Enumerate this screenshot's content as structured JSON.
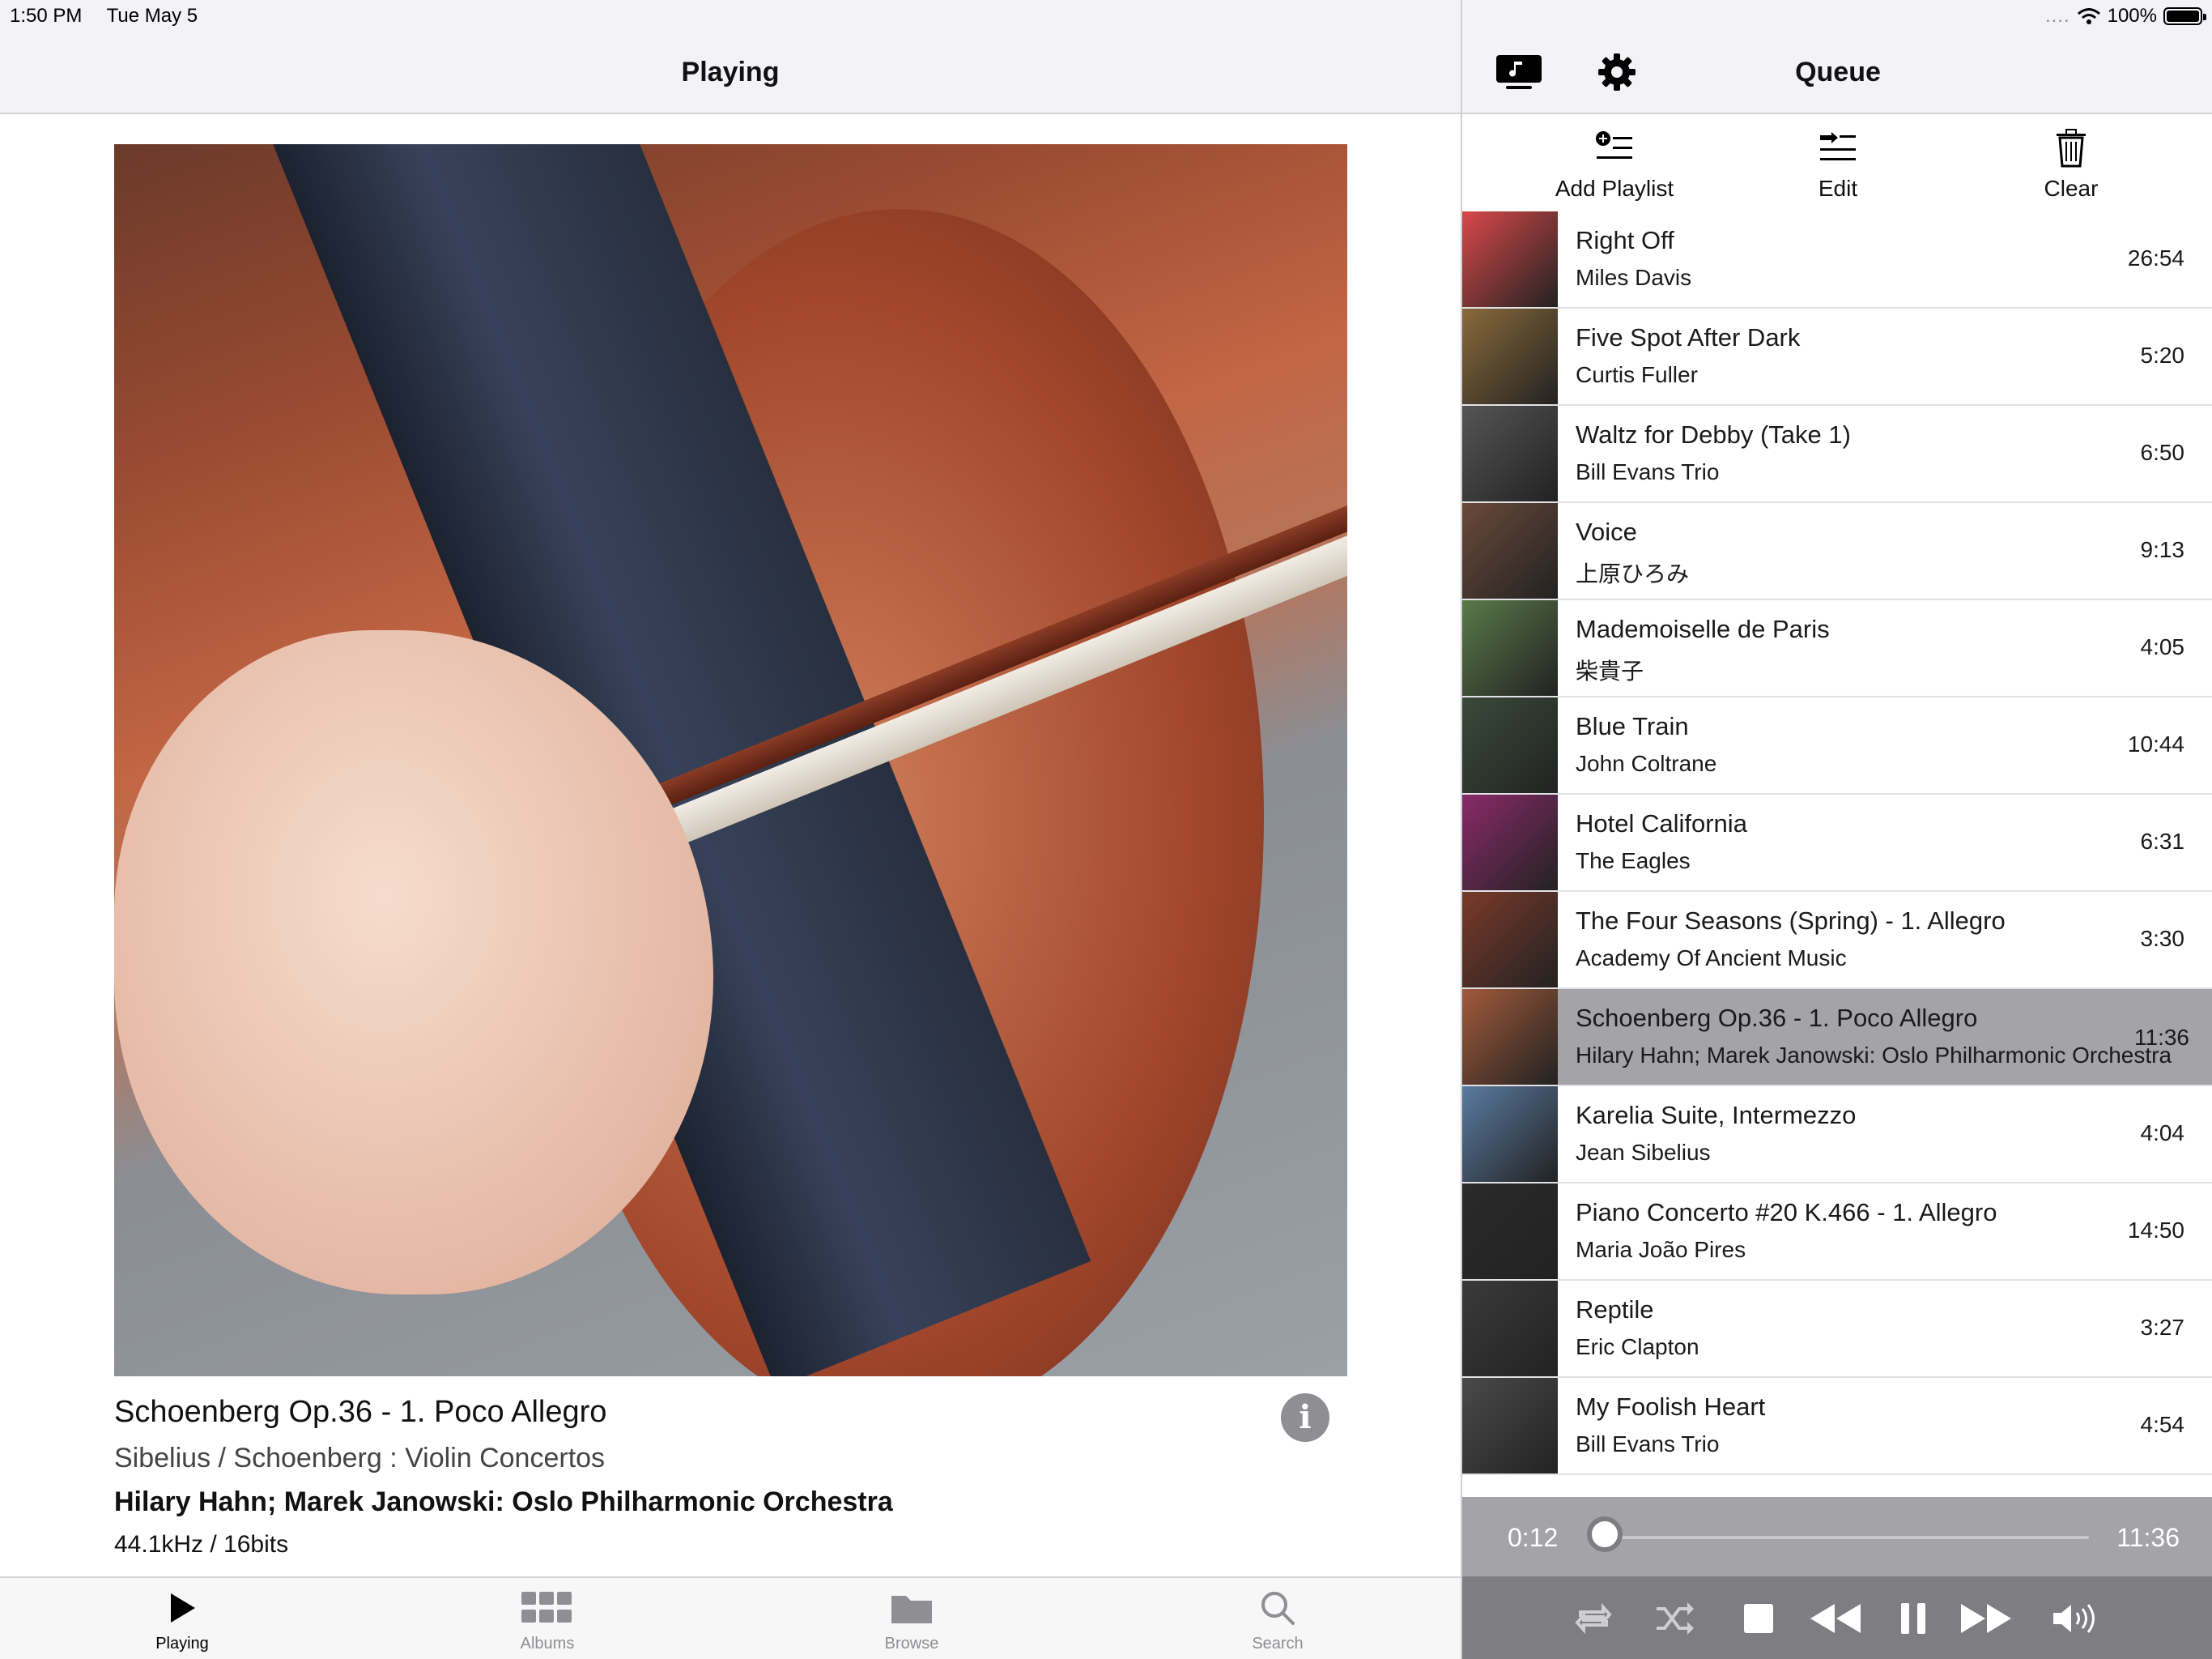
{
  "status_bar": {
    "time": "1:50 PM",
    "date": "Tue May 5",
    "signal": "....",
    "battery_label": "100%",
    "battery_level": 1.0
  },
  "now_playing": {
    "header_title": "Playing",
    "artwork_icon": "cello-album-art",
    "track_title": "Schoenberg Op.36 - 1. Poco Allegro",
    "album": "Sibelius / Schoenberg : Violin Concertos",
    "artist": "Hilary Hahn; Marek Janowski: Oslo Philharmonic Orchestra",
    "format": "44.1kHz / 16bits",
    "info_label": "i"
  },
  "tab_bar": {
    "tabs": [
      {
        "label": "Playing",
        "icon": "play-icon",
        "active": true
      },
      {
        "label": "Albums",
        "icon": "grid-icon",
        "active": false
      },
      {
        "label": "Browse",
        "icon": "folder-icon",
        "active": false
      },
      {
        "label": "Search",
        "icon": "search-icon",
        "active": false
      }
    ]
  },
  "queue": {
    "header_title": "Queue",
    "actions": {
      "add_playlist": "Add Playlist",
      "edit": "Edit",
      "clear": "Clear"
    },
    "items": [
      {
        "title": "Right Off",
        "artist": "Miles Davis",
        "duration": "26:54",
        "thumb": "#d9484a"
      },
      {
        "title": "Five Spot After Dark",
        "artist": "Curtis Fuller",
        "duration": "5:20",
        "thumb": "#8a6a3a"
      },
      {
        "title": "Waltz for Debby (Take 1)",
        "artist": "Bill Evans Trio",
        "duration": "6:50",
        "thumb": "#555555"
      },
      {
        "title": "Voice",
        "artist": "上原ひろみ",
        "duration": "9:13",
        "thumb": "#6a4a3a"
      },
      {
        "title": "Mademoiselle de Paris",
        "artist": "柴貴子",
        "duration": "4:05",
        "thumb": "#5a7a4a"
      },
      {
        "title": "Blue Train",
        "artist": "John Coltrane",
        "duration": "10:44",
        "thumb": "#3a4a3a"
      },
      {
        "title": "Hotel California",
        "artist": "The Eagles",
        "duration": "6:31",
        "thumb": "#8a2a6a"
      },
      {
        "title": "The Four Seasons (Spring) - 1. Allegro",
        "artist": "Academy Of Ancient Music",
        "duration": "3:30",
        "thumb": "#7a3a2a"
      },
      {
        "title": "Schoenberg Op.36 - 1. Poco Allegro",
        "artist": "Hilary Hahn; Marek Janowski: Oslo Philharmonic Orchestra",
        "duration": "11:36",
        "thumb": "#a05a3a",
        "current": true
      },
      {
        "title": "Karelia Suite, Intermezzo",
        "artist": "Jean Sibelius",
        "duration": "4:04",
        "thumb": "#5a7aa0"
      },
      {
        "title": "Piano Concerto #20 K.466 - 1. Allegro",
        "artist": "Maria João Pires",
        "duration": "14:50",
        "thumb": "#2a2a2a"
      },
      {
        "title": "Reptile",
        "artist": "Eric Clapton",
        "duration": "3:27",
        "thumb": "#3a3a3a"
      },
      {
        "title": "My Foolish Heart",
        "artist": "Bill Evans Trio",
        "duration": "4:54",
        "thumb": "#4a4a4a"
      }
    ]
  },
  "player": {
    "elapsed": "0:12",
    "total": "11:36",
    "progress_fraction": 0.017
  },
  "colors": {
    "header_bg": "#f2f2f7",
    "current_row_bg": "#a3a3a8",
    "controls_bg": "#7d7d82"
  }
}
